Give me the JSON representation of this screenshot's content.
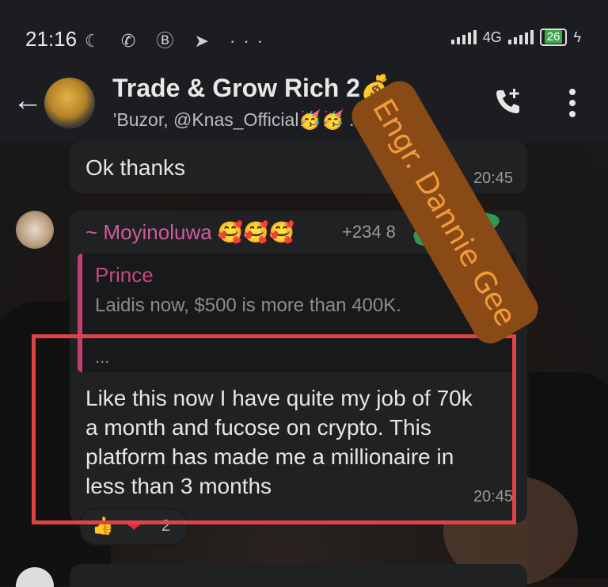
{
  "status_bar": {
    "time": "21:16",
    "left_icons": "☾ ✆ Ⓑ ➤ ···",
    "network_label": "4G",
    "battery": "26",
    "charging_glyph": "ϟ"
  },
  "header": {
    "title": "Trade & Grow Rich 2💰",
    "subtitle": "'Buzor, @Knas_Official🥳🥳 ...701..."
  },
  "messages": [
    {
      "text": "Ok thanks",
      "time": "20:45"
    },
    {
      "sender": "~ Moyinoluwa 🥰🥰🥰",
      "phone": "+234 8",
      "quote": {
        "name": "Prince",
        "text": "Laidis now, $500 is more than 400K.",
        "ellipsis": "..."
      },
      "text": "Like this now I have quite my job of 70k a month and fucose on crypto. This platform has made me a millionaire in less than 3 months",
      "time": "20:45",
      "reactions": {
        "first": "👍",
        "second": "❤",
        "count": "2"
      }
    }
  ],
  "watermark": "Engr. Dannie Gee",
  "colors": {
    "sender": "#d05c9a",
    "quote_accent": "#c43d73",
    "highlight_box": "#e04245",
    "watermark_bg": "#8a4a16",
    "watermark_text": "#f09a3a"
  }
}
